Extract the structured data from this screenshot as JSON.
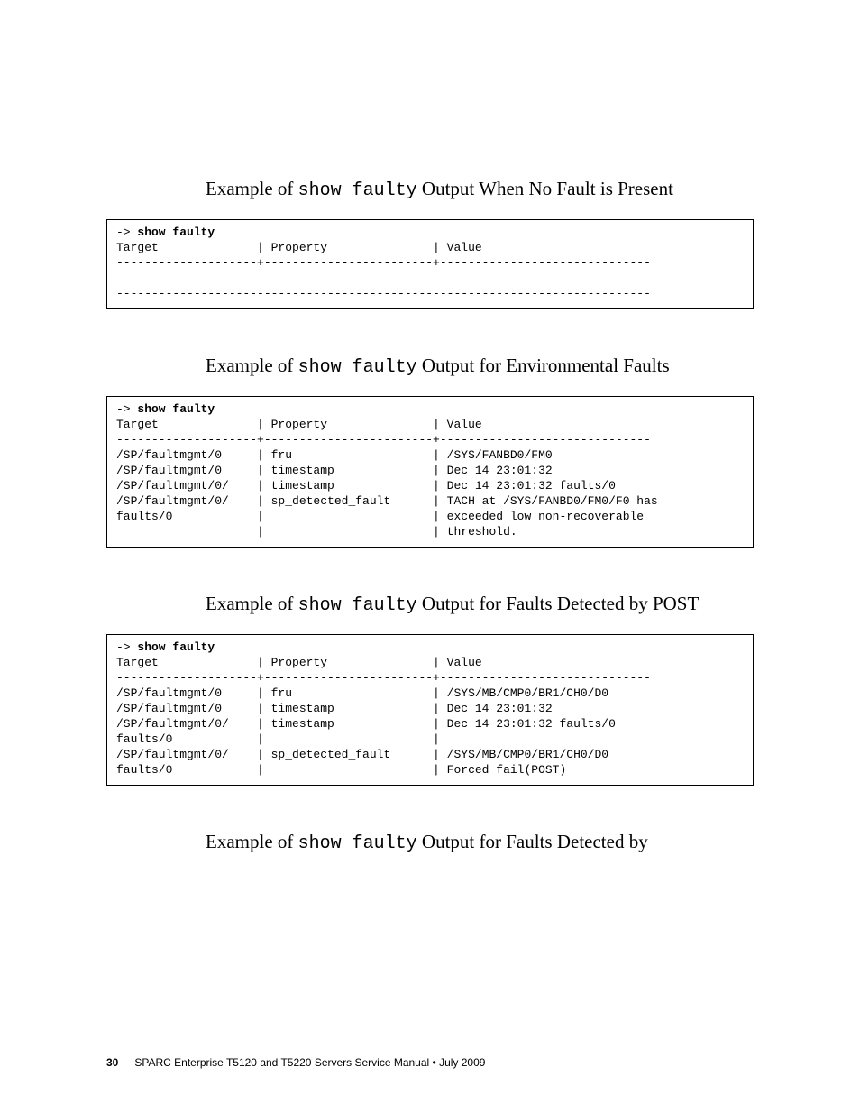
{
  "headings": {
    "h1_pre": "Example of ",
    "h1_cmd": "show faulty",
    "h1_post": " Output When No Fault is Present",
    "h2_pre": "Example of ",
    "h2_cmd": "show faulty",
    "h2_post": " Output for Environmental Faults",
    "h3_pre": "Example of ",
    "h3_cmd": "show faulty",
    "h3_post": " Output for Faults Detected by POST",
    "h4_pre": "Example of ",
    "h4_cmd": "show faulty",
    "h4_post": " Output for Faults Detected by"
  },
  "term1": {
    "prompt": "-> ",
    "cmd": "show faulty",
    "body": "Target              | Property               | Value\n--------------------+------------------------+------------------------------\n\n----------------------------------------------------------------------------"
  },
  "term2": {
    "prompt": "-> ",
    "cmd": "show faulty",
    "body": "Target              | Property               | Value\n--------------------+------------------------+------------------------------\n/SP/faultmgmt/0     | fru                    | /SYS/FANBD0/FM0\n/SP/faultmgmt/0     | timestamp              | Dec 14 23:01:32\n/SP/faultmgmt/0/    | timestamp              | Dec 14 23:01:32 faults/0\n/SP/faultmgmt/0/    | sp_detected_fault      | TACH at /SYS/FANBD0/FM0/F0 has\nfaults/0            |                        | exceeded low non-recoverable\n                    |                        | threshold."
  },
  "term3": {
    "prompt": "-> ",
    "cmd": "show faulty",
    "body": "Target              | Property               | Value\n--------------------+------------------------+------------------------------\n/SP/faultmgmt/0     | fru                    | /SYS/MB/CMP0/BR1/CH0/D0\n/SP/faultmgmt/0     | timestamp              | Dec 14 23:01:32\n/SP/faultmgmt/0/    | timestamp              | Dec 14 23:01:32 faults/0\nfaults/0            |                        |\n/SP/faultmgmt/0/    | sp_detected_fault      | /SYS/MB/CMP0/BR1/CH0/D0\nfaults/0            |                        | Forced fail(POST)"
  },
  "footer": {
    "page_number": "30",
    "text": "SPARC Enterprise T5120 and T5220 Servers Service Manual • July 2009"
  }
}
